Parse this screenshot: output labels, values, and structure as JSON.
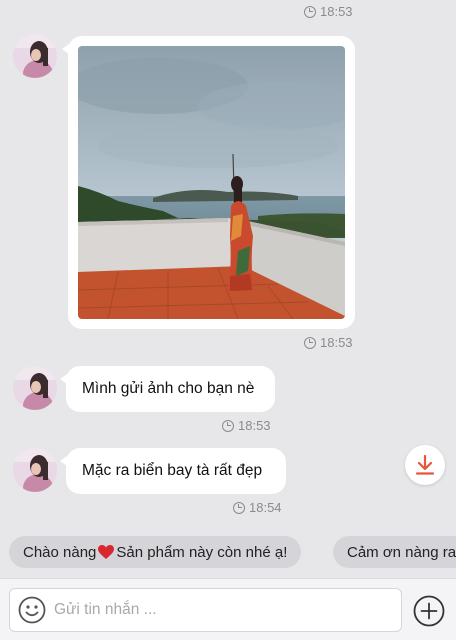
{
  "messages": [
    {
      "time": "18:53"
    },
    {
      "time": "18:53",
      "text": "Mình gửi ảnh cho bạn nè"
    },
    {
      "time": "18:54",
      "text": "Mặc ra biển bay tà rất đẹp"
    }
  ],
  "top_time": "18:53",
  "quick_replies": {
    "chip1_pre": "Chào nàng",
    "chip1_post": " Sản phẩm này còn nhé ạ!",
    "chip2": "Cảm ơn nàng ra"
  },
  "composer": {
    "placeholder": "Gửi tin nhắn ..."
  },
  "icons": {
    "download": "download-icon",
    "emoji": "smiley-icon",
    "plus": "plus-circle-icon",
    "heart": "heart-icon",
    "clock": "clock-icon"
  },
  "colors": {
    "accent": "#e8553c",
    "heart": "#d7282f",
    "bubble": "#ffffff",
    "background": "#e7e7ea"
  }
}
